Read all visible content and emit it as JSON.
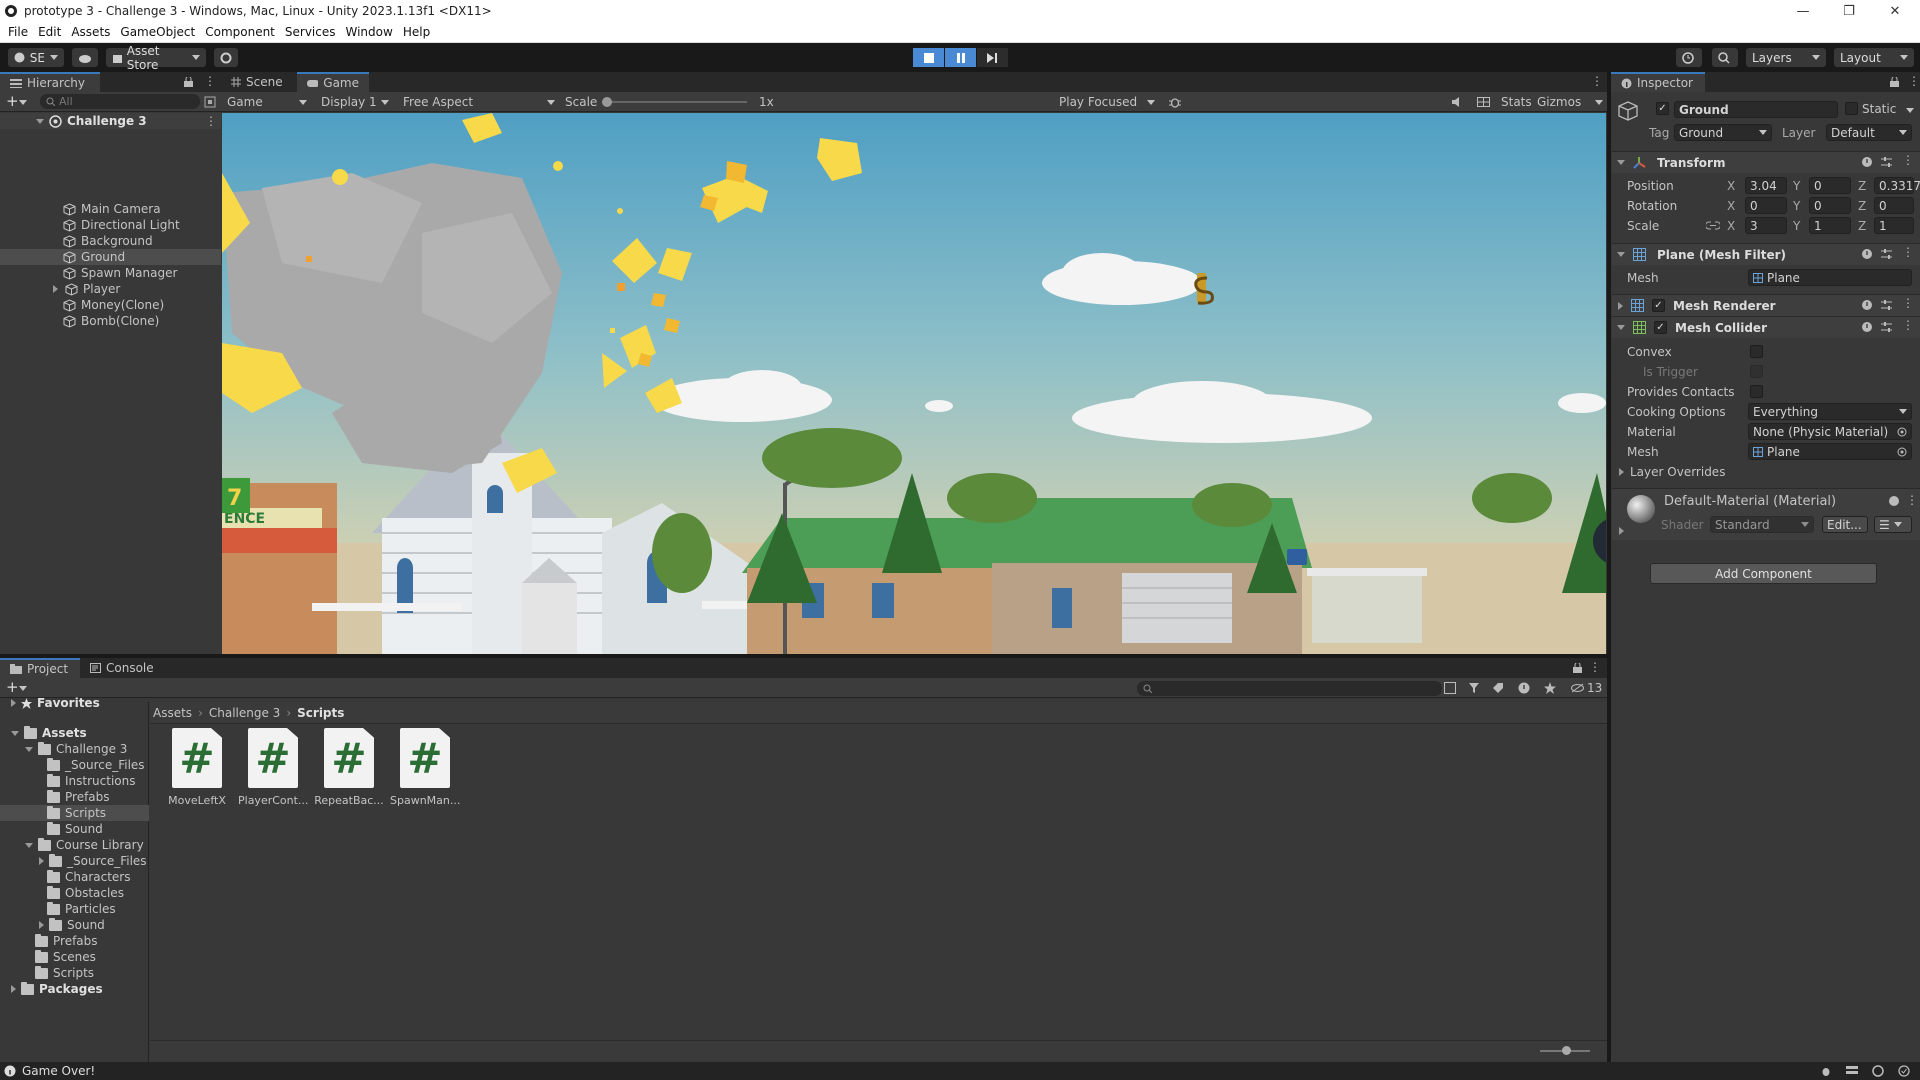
{
  "window": {
    "title": "prototype 3 - Challenge 3 - Windows, Mac, Linux - Unity 2023.1.13f1 <DX11>"
  },
  "menu": [
    "File",
    "Edit",
    "Assets",
    "GameObject",
    "Component",
    "Services",
    "Window",
    "Help"
  ],
  "toolbar": {
    "account": "SE",
    "asset_store": "Asset Store",
    "layers": "Layers",
    "layout": "Layout"
  },
  "hierarchy": {
    "tab": "Hierarchy",
    "search_placeholder": "All",
    "scene": "Challenge 3",
    "items": [
      "Main Camera",
      "Directional Light",
      "Background",
      "Ground",
      "Spawn Manager",
      "Player",
      "Money(Clone)",
      "Bomb(Clone)"
    ],
    "selected": "Ground"
  },
  "game_view": {
    "tabs": [
      "Scene",
      "Game"
    ],
    "active_tab": "Game",
    "mode": "Game",
    "display": "Display 1",
    "aspect": "Free Aspect",
    "scale_label": "Scale",
    "scale_value": "1x",
    "play_mode": "Play Focused",
    "stats": "Stats",
    "gizmos": "Gizmos",
    "sign_text": "ENCE",
    "sign_digit": "7"
  },
  "inspector": {
    "tab": "Inspector",
    "object_name": "Ground",
    "static_label": "Static",
    "tag_label": "Tag",
    "tag_value": "Ground",
    "layer_label": "Layer",
    "layer_value": "Default",
    "transform": {
      "title": "Transform",
      "position_label": "Position",
      "rotation_label": "Rotation",
      "scale_label": "Scale",
      "position": {
        "x": "3.04",
        "y": "0",
        "z": "0.3317"
      },
      "rotation": {
        "x": "0",
        "y": "0",
        "z": "0"
      },
      "scale": {
        "x": "3",
        "y": "1",
        "z": "1"
      }
    },
    "mesh_filter": {
      "title": "Plane (Mesh Filter)",
      "mesh_label": "Mesh",
      "mesh_value": "Plane"
    },
    "mesh_renderer": {
      "title": "Mesh Renderer"
    },
    "mesh_collider": {
      "title": "Mesh Collider",
      "convex": "Convex",
      "is_trigger": "Is Trigger",
      "provides_contacts": "Provides Contacts",
      "cooking_label": "Cooking Options",
      "cooking_value": "Everything",
      "material_label": "Material",
      "material_value": "None (Physic Material)",
      "mesh_label": "Mesh",
      "mesh_value": "Plane"
    },
    "layer_overrides": "Layer Overrides",
    "material": {
      "title": "Default-Material (Material)",
      "shader_label": "Shader",
      "shader_value": "Standard",
      "edit": "Edit..."
    },
    "add_component": "Add Component"
  },
  "project": {
    "tabs": [
      "Project",
      "Console"
    ],
    "hidden_count": "13",
    "breadcrumb": [
      "Assets",
      "Challenge 3",
      "Scripts"
    ],
    "favorites": "Favorites",
    "assets_root": "Assets",
    "tree": {
      "challenge3": "Challenge 3",
      "c3_children": [
        "_Source_Files",
        "Instructions",
        "Prefabs",
        "Scripts",
        "Sound"
      ],
      "course_library": "Course Library",
      "cl_children": [
        "_Source_Files",
        "Characters",
        "Obstacles",
        "Particles",
        "Sound"
      ],
      "root_children": [
        "Prefabs",
        "Scenes",
        "Scripts"
      ],
      "packages": "Packages"
    },
    "files": [
      "MoveLeftX",
      "PlayerCont...",
      "RepeatBac...",
      "SpawnMan..."
    ],
    "file_glyph": "#"
  },
  "status": {
    "message": "Game Over!"
  },
  "colors": {
    "accent": "#3a79bb",
    "play_active": "#4a8ad4",
    "sky_top": "#4f9fc4",
    "sky_bottom": "#efd9a8"
  }
}
